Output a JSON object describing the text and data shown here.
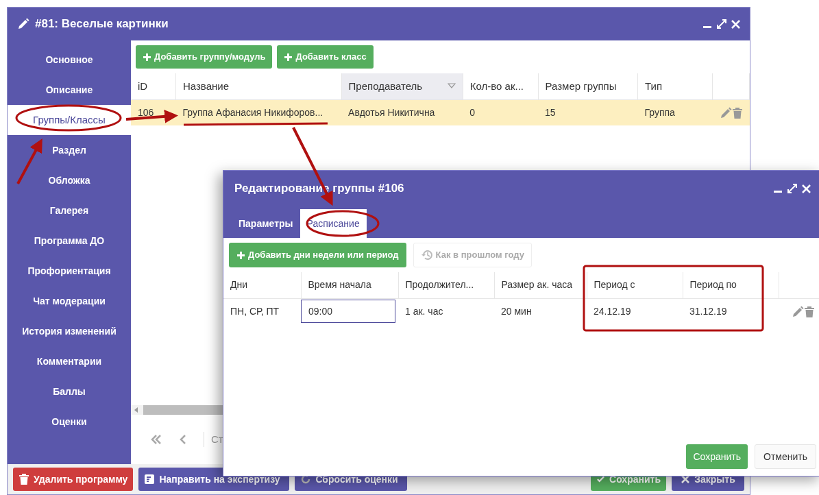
{
  "window": {
    "title": "#81: Веселые картинки"
  },
  "sidebar": {
    "items": [
      {
        "label": "Основное",
        "selected": false
      },
      {
        "label": "Описание",
        "selected": false
      },
      {
        "label": "Группы/Классы",
        "selected": true
      },
      {
        "label": "Раздел",
        "selected": false
      },
      {
        "label": "Обложка",
        "selected": false
      },
      {
        "label": "Галерея",
        "selected": false
      },
      {
        "label": "Программа ДО",
        "selected": false
      },
      {
        "label": "Профориентация",
        "selected": false
      },
      {
        "label": "Чат модерации",
        "selected": false
      },
      {
        "label": "История изменений",
        "selected": false
      },
      {
        "label": "Комментарии",
        "selected": false
      },
      {
        "label": "Баллы",
        "selected": false
      },
      {
        "label": "Оценки",
        "selected": false
      }
    ]
  },
  "toolbar": {
    "buttons": [
      "Добавить группу/модуль",
      "Добавить класс"
    ]
  },
  "table": {
    "columns": [
      {
        "label": "iD",
        "highlighted": false
      },
      {
        "label": "Название",
        "highlighted": false
      },
      {
        "label": "Преподаватель",
        "highlighted": true
      },
      {
        "label": "Кол-во ак...",
        "highlighted": false
      },
      {
        "label": "Размер группы",
        "highlighted": false
      },
      {
        "label": "Тип",
        "highlighted": false
      }
    ],
    "rows": [
      {
        "selected": true,
        "cells": [
          "106",
          "Группа Афанасия Никифоров...",
          "Авдотья Никитична",
          "0",
          "15",
          "Группа"
        ]
      }
    ]
  },
  "pagination": {
    "text": "Ст"
  },
  "footer": {
    "buttons": [
      {
        "label": "Удалить программу",
        "kind": "delete"
      },
      {
        "label": "Направить на экспертизу",
        "kind": "send"
      },
      {
        "label": "Сбросить оценки",
        "kind": "reset"
      },
      {
        "label": "Сохранить",
        "kind": "save"
      },
      {
        "label": "Закрыть",
        "kind": "close"
      }
    ]
  },
  "dialog": {
    "title": "Редактирование группы #106",
    "tabs": [
      {
        "label": "Параметры",
        "selected": false
      },
      {
        "label": "Расписание",
        "selected": true
      }
    ],
    "toolbar": [
      {
        "label": "Добавить дни недели или период",
        "kind": "add",
        "disabled": false
      },
      {
        "label": "Как в прошлом году",
        "kind": "history",
        "disabled": true
      }
    ],
    "columns": [
      "Дни",
      "Время начала",
      "Продолжител...",
      "Размер ак. часа",
      "Период с",
      "Период по"
    ],
    "rows": [
      {
        "days": "ПН, СР, ПТ",
        "start_time": "09:00",
        "duration": "1 ак. час",
        "hour_size": "20 мин",
        "period_from": "24.12.19",
        "period_to": "31.12.19"
      }
    ],
    "buttons": [
      {
        "label": "Сохранить",
        "kind": "primary"
      },
      {
        "label": "Отменить",
        "kind": "secondary"
      }
    ]
  }
}
